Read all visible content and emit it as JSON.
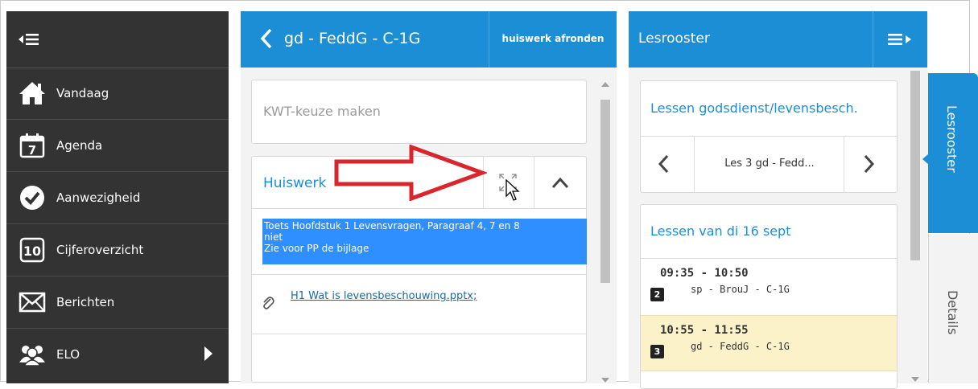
{
  "sidebar": {
    "items": [
      {
        "label": "Vandaag",
        "icon": "home-icon"
      },
      {
        "label": "Agenda",
        "icon": "calendar-icon",
        "icon_text": "7"
      },
      {
        "label": "Aanwezigheid",
        "icon": "checkmark-icon"
      },
      {
        "label": "Cijferoverzicht",
        "icon": "grades-icon",
        "icon_text": "10"
      },
      {
        "label": "Berichten",
        "icon": "envelope-icon"
      },
      {
        "label": "ELO",
        "icon": "users-icon"
      }
    ]
  },
  "lesson_panel": {
    "title": "gd - FeddG - C-1G",
    "finish_button": "huiswerk afronden",
    "kwt_label": "KWT-keuze maken",
    "homework": {
      "title": "Huiswerk",
      "text_lines": [
        "Toets Hoofdstuk 1 Levensvragen, Paragraaf 4, 7 en 8",
        "niet",
        "Zie voor PP de bijlage"
      ],
      "attachment": "H1 Wat is levensbeschouwing.pptx;"
    }
  },
  "schedule_panel": {
    "title": "Lesrooster",
    "lessons_card_title": "Lessen godsdienst/levensbesch.",
    "current_lesson": "Les 3 gd - Fedd...",
    "day_title": "Lessen van di 16 sept",
    "lessons": [
      {
        "time": "09:35 - 10:50",
        "number": "2",
        "name": "sp - BrouJ - C-1G"
      },
      {
        "time": "10:55 - 11:55",
        "number": "3",
        "name": "gd - FeddG - C-1G"
      }
    ]
  },
  "side_tabs": {
    "active": "Lesrooster",
    "inactive": "Details"
  },
  "colors": {
    "sidebar": "#333333",
    "accent": "#1c8ed6",
    "selection": "#2f8fff",
    "highlight_lesson": "#fbf2ca",
    "annotation": "#d9262c"
  }
}
